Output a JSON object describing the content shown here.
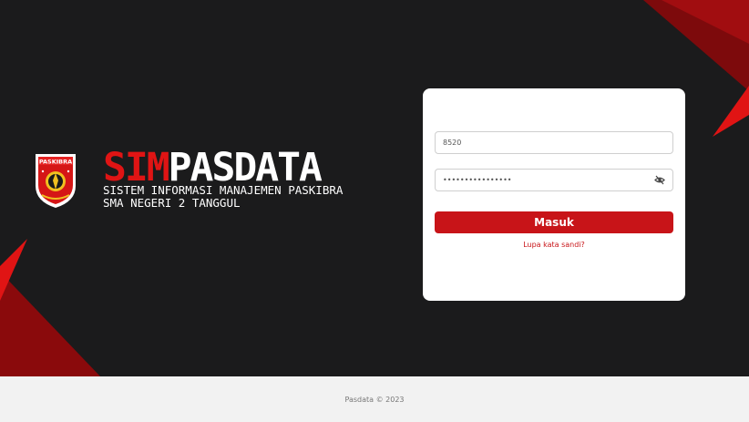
{
  "brand": {
    "title_sim": "SIM",
    "title_pasdata": "PASDATA",
    "subtitle_line1": "SISTEM INFORMASI MANAJEMEN PASKIBRA",
    "subtitle_line2": "SMA NEGERI 2 TANGGUL",
    "logo_text": "PASKIBRA"
  },
  "login": {
    "username_value": "8520",
    "password_value": "••••••••••••••••",
    "password_toggle_icon": "eye-off-icon",
    "submit_label": "Masuk",
    "forgot_label": "Lupa kata sandi?"
  },
  "footer": {
    "text": "Pasdata © 2023"
  },
  "colors": {
    "background": "#1b1b1c",
    "accent": "#c81418",
    "accent_dark": "#8a0a0c",
    "card": "#ffffff",
    "footer": "#f2f2f2"
  }
}
